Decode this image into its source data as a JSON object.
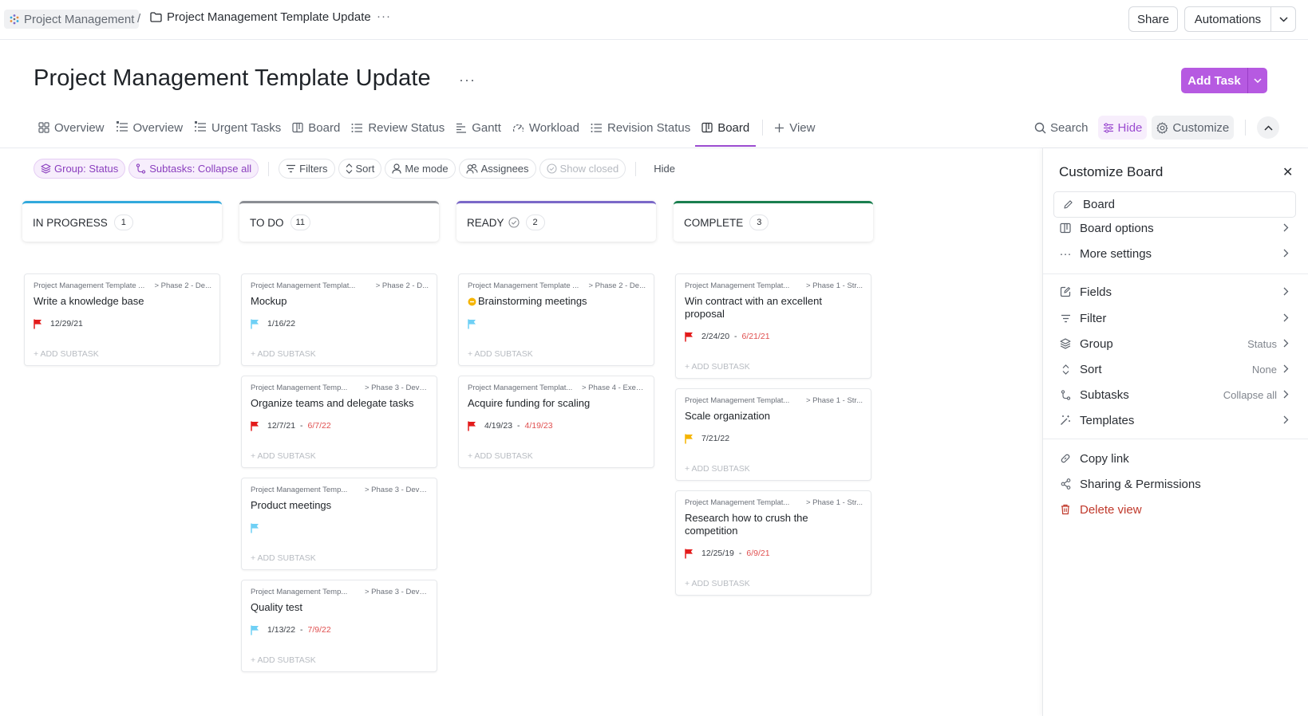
{
  "breadcrumb": {
    "root": "Project Management",
    "separator": "/",
    "current": "Project Management Template Update",
    "more": "···"
  },
  "header": {
    "share": "Share",
    "automations": "Automations"
  },
  "page": {
    "title": "Project Management Template Update",
    "more": "···",
    "add_task": "Add Task"
  },
  "tabs": [
    {
      "label": "Overview",
      "icon": "dashboard-icon",
      "active": false
    },
    {
      "label": "Overview",
      "icon": "pinned-list-icon",
      "active": false
    },
    {
      "label": "Urgent Tasks",
      "icon": "pinned-list-icon",
      "active": false
    },
    {
      "label": "Board",
      "icon": "board-icon",
      "active": false
    },
    {
      "label": "Review Status",
      "icon": "list-icon",
      "active": false
    },
    {
      "label": "Gantt",
      "icon": "gantt-icon",
      "active": false
    },
    {
      "label": "Workload",
      "icon": "gauge-icon",
      "active": false
    },
    {
      "label": "Revision Status",
      "icon": "list-icon",
      "active": false
    },
    {
      "label": "Board",
      "icon": "board-icon",
      "active": true
    }
  ],
  "add_view": "View",
  "tools": {
    "search": "Search",
    "hide": "Hide",
    "customize": "Customize"
  },
  "filters": {
    "group": "Group: Status",
    "subtasks": "Subtasks: Collapse all",
    "filters": "Filters",
    "sort": "Sort",
    "me_mode": "Me mode",
    "assignees": "Assignees",
    "show_closed": "Show closed",
    "hide": "Hide"
  },
  "colors": {
    "accent": "#b65ae1",
    "in_progress": "#32a9dc",
    "todo": "#8a8d93",
    "ready": "#7b68c8",
    "complete": "#1a7f4f",
    "flag_urgent": "#e31b1b",
    "flag_normal": "#6fd0f5",
    "flag_high": "#f5b400",
    "due_overdue": "#e04f4f"
  },
  "columns": [
    {
      "name": "IN PROGRESS",
      "count": "1",
      "color": "#32a9dc",
      "check": false,
      "cards": [
        {
          "path": "Project Management Template ...",
          "phase": "> Phase 2 - De...",
          "title": "Write a knowledge base",
          "flag": "urgent",
          "start": "12/29/21",
          "due": "",
          "status_dot": false,
          "add_subtask": "+ ADD SUBTASK"
        }
      ]
    },
    {
      "name": "TO DO",
      "count": "11",
      "color": "#8a8d93",
      "check": false,
      "cards": [
        {
          "path": "Project Management Templat...",
          "phase": "> Phase 2 - D...",
          "title": "Mockup",
          "flag": "normal",
          "start": "1/16/22",
          "due": "",
          "status_dot": false,
          "add_subtask": "+ ADD SUBTASK"
        },
        {
          "path": "Project Management Temp...",
          "phase": "> Phase 3 - Devel...",
          "title": "Organize teams and delegate tasks",
          "flag": "urgent",
          "start": "12/7/21",
          "due": "6/7/22",
          "status_dot": false,
          "add_subtask": "+ ADD SUBTASK"
        },
        {
          "path": "Project Management Temp...",
          "phase": "> Phase 3 - Devel...",
          "title": "Product meetings",
          "flag": "normal",
          "start": "",
          "due": "",
          "status_dot": false,
          "add_subtask": "+ ADD SUBTASK"
        },
        {
          "path": "Project Management Temp...",
          "phase": "> Phase 3 - Devel...",
          "title": "Quality test",
          "flag": "normal",
          "start": "1/13/22",
          "due": "7/9/22",
          "status_dot": false,
          "add_subtask": "+ ADD SUBTASK"
        }
      ]
    },
    {
      "name": "READY",
      "count": "2",
      "color": "#7b68c8",
      "check": true,
      "cards": [
        {
          "path": "Project Management Template ...",
          "phase": "> Phase 2 - De...",
          "title": "Brainstorming meetings",
          "flag": "normal",
          "start": "",
          "due": "",
          "status_dot": true,
          "add_subtask": "+ ADD SUBTASK"
        },
        {
          "path": "Project Management Templat...",
          "phase": "> Phase 4 - Exec...",
          "title": "Acquire funding for scaling",
          "flag": "urgent",
          "start": "4/19/23",
          "due": "4/19/23",
          "status_dot": false,
          "add_subtask": "+ ADD SUBTASK"
        }
      ]
    },
    {
      "name": "COMPLETE",
      "count": "3",
      "color": "#1a7f4f",
      "check": false,
      "cards": [
        {
          "path": "Project Management Templat...",
          "phase": "> Phase 1 - Str...",
          "title": "Win contract with an excellent proposal",
          "flag": "urgent",
          "start": "2/24/20",
          "due": "6/21/21",
          "status_dot": false,
          "add_subtask": "+ ADD SUBTASK"
        },
        {
          "path": "Project Management Templat...",
          "phase": "> Phase 1 - Str...",
          "title": "Scale organization",
          "flag": "high",
          "start": "7/21/22",
          "due": "",
          "status_dot": false,
          "add_subtask": "+ ADD SUBTASK"
        },
        {
          "path": "Project Management Templat...",
          "phase": "> Phase 1 - Str...",
          "title": "Research how to crush the competition",
          "flag": "urgent",
          "start": "12/25/19",
          "due": "6/9/21",
          "status_dot": false,
          "add_subtask": "+ ADD SUBTASK"
        }
      ]
    }
  ],
  "panel": {
    "title": "Customize Board",
    "view_name": "Board",
    "items": {
      "board_options": "Board options",
      "more_settings": "More settings",
      "fields": "Fields",
      "filter": "Filter",
      "group": "Group",
      "group_value": "Status",
      "sort": "Sort",
      "sort_value": "None",
      "subtasks": "Subtasks",
      "subtasks_value": "Collapse all",
      "templates": "Templates",
      "copy_link": "Copy link",
      "sharing": "Sharing & Permissions",
      "delete_view": "Delete view"
    }
  }
}
